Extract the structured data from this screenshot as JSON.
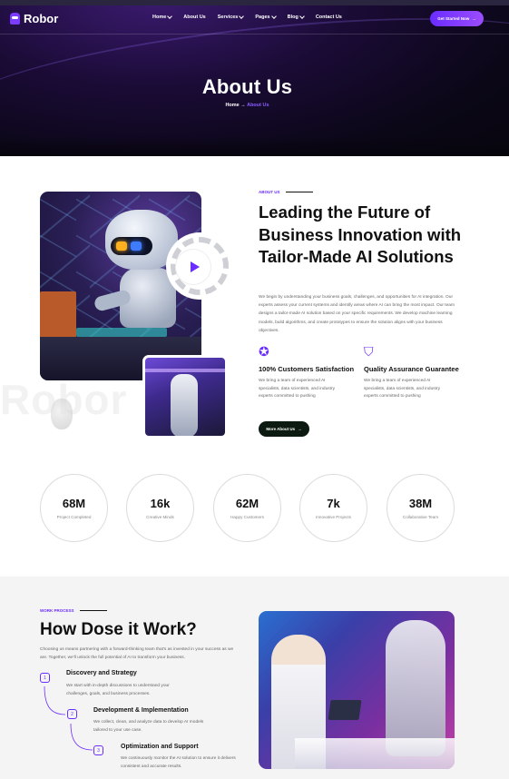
{
  "header": {
    "logo": "Robor",
    "menu": [
      {
        "label": "Home",
        "dropdown": true
      },
      {
        "label": "About Us",
        "dropdown": false
      },
      {
        "label": "Services",
        "dropdown": true
      },
      {
        "label": "Pages",
        "dropdown": true
      },
      {
        "label": "Blog",
        "dropdown": true
      },
      {
        "label": "Contact Us",
        "dropdown": false
      }
    ],
    "cta": "Get Started Now",
    "cta_icon": "arrow-right-icon"
  },
  "hero": {
    "title": "About Us",
    "breadcrumb_home": "Home",
    "breadcrumb_separator": "→",
    "breadcrumb_current": "About Us"
  },
  "about": {
    "label": "ABOUT US",
    "title": "Leading the Future of Business Innovation with Tailor-Made AI Solutions",
    "description": "We begin by understanding your business goals, challenges, and opportunities for AI integration. Our experts assess your current systems and identify areas where AI can bring the most impact. Our team designs a tailor-made AI solution based on your specific requirements. We develop machine learning models, build algorithms, and create prototypes to ensure the solution aligns with your business objectives.",
    "features": [
      {
        "icon": "customer-satisfaction-icon",
        "title": "100% Customers Satisfaction",
        "desc": "We bring a team of experienced AI specialists, data scientists, and industry experts committed to pushing"
      },
      {
        "icon": "shield-check-icon",
        "title": "Quality Assurance Guarantee",
        "desc": "We bring a team of experienced AI specialists, data scientists, and industry experts committed to pushing"
      }
    ],
    "button": "More About Us",
    "watermark": "Robor"
  },
  "stats": [
    {
      "value": "68M",
      "label": "Project Completed"
    },
    {
      "value": "16k",
      "label": "Creative Minds"
    },
    {
      "value": "62M",
      "label": "Happy Customers"
    },
    {
      "value": "7k",
      "label": "Innovative Projects"
    },
    {
      "value": "38M",
      "label": "Collaborative Team"
    }
  ],
  "process": {
    "label": "WORK PROCESS",
    "title": "How Dose it Work?",
    "description": "Choosing us means partnering with a forward-thinking team that's as invested in your success as we are. Together, we'll unlock the full potential of AI to transform your business.",
    "steps": [
      {
        "num": "1",
        "title": "Discovery and Strategy",
        "desc": "We start with in-depth discussions to understand your challenges, goals, and business processes."
      },
      {
        "num": "2",
        "title": "Development & Implementation",
        "desc": "We collect, clean, and analyze data to develop AI models tailored to your use case."
      },
      {
        "num": "3",
        "title": "Optimization and Support",
        "desc": "We continuously monitor the AI solution to ensure it delivers consistent and accurate results."
      }
    ]
  },
  "colors": {
    "accent": "#6b2cff",
    "dark": "#0b0717",
    "button_dark": "#0d1a12"
  }
}
